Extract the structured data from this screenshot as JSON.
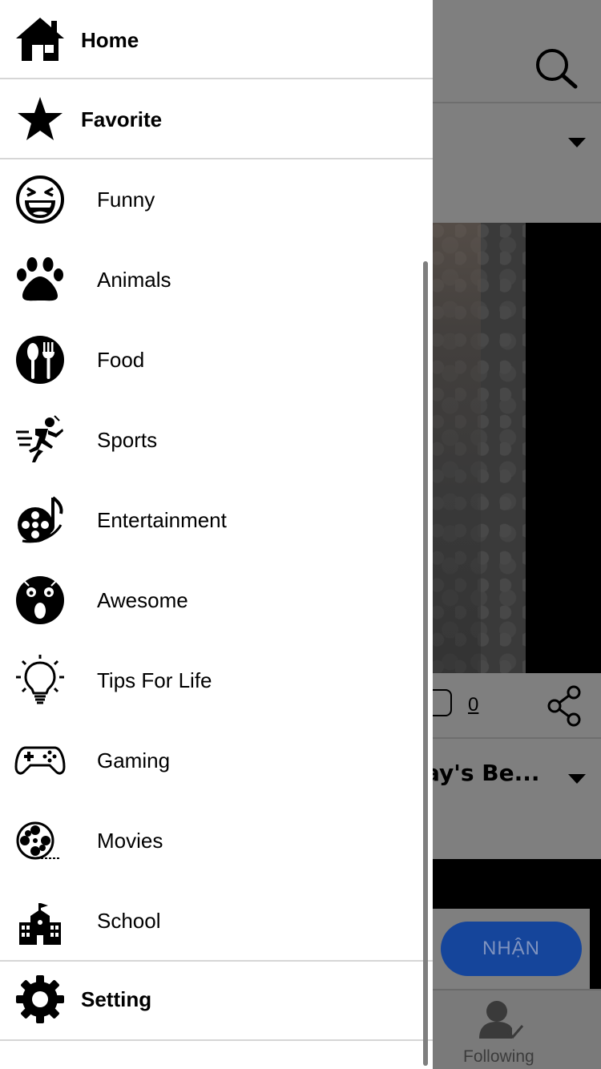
{
  "drawer": {
    "home_label": "Home",
    "favorite_label": "Favorite",
    "setting_label": "Setting",
    "categories": [
      {
        "label": "Funny",
        "icon": "laughing-face-icon"
      },
      {
        "label": "Animals",
        "icon": "paw-icon"
      },
      {
        "label": "Food",
        "icon": "fork-spoon-icon"
      },
      {
        "label": "Sports",
        "icon": "running-person-icon"
      },
      {
        "label": "Entertainment",
        "icon": "film-music-icon"
      },
      {
        "label": "Awesome",
        "icon": "shocked-face-icon"
      },
      {
        "label": "Tips For Life",
        "icon": "lightbulb-icon"
      },
      {
        "label": "Gaming",
        "icon": "gamepad-icon"
      },
      {
        "label": "Movies",
        "icon": "film-reel-icon"
      },
      {
        "label": "School",
        "icon": "school-building-icon"
      }
    ]
  },
  "background": {
    "comment_count": "0",
    "post_title": "ay's Be...",
    "ad_button_label": "NHẬN",
    "tab_following_label": "Following"
  },
  "colors": {
    "overlay": "#7f7f7f",
    "ad_button": "#15459b",
    "divider": "#d6d6d6"
  }
}
